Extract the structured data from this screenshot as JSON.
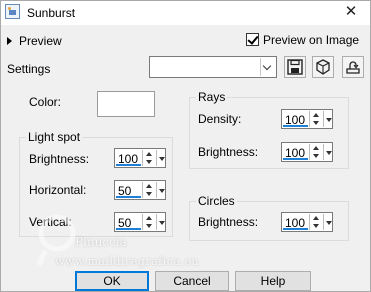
{
  "window": {
    "title": "Sunburst",
    "close_glyph": "✕"
  },
  "preview": {
    "label": "Preview",
    "preview_on_image_label": "Preview on Image",
    "preview_on_image_checked": true
  },
  "settings": {
    "label": "Settings",
    "selected_value": "",
    "icons": [
      "save-preset-icon",
      "reset-icon",
      "load-preset-icon"
    ]
  },
  "color": {
    "label": "Color:",
    "value": "#ffffff"
  },
  "light_spot": {
    "title": "Light spot",
    "brightness_label": "Brightness:",
    "brightness_value": "100",
    "horizontal_label": "Horizontal:",
    "horizontal_value": "50",
    "vertical_label": "Vertical:",
    "vertical_value": "50"
  },
  "rays": {
    "title": "Rays",
    "density_label": "Density:",
    "density_value": "100",
    "brightness_label": "Brightness:",
    "brightness_value": "100"
  },
  "circles": {
    "title": "Circles",
    "brightness_label": "Brightness:",
    "brightness_value": "100"
  },
  "buttons": {
    "ok": "OK",
    "cancel": "Cancel",
    "help": "Help"
  },
  "watermark": {
    "line1": "Pinuccia",
    "line2": "www.maildiregrafica.eu"
  },
  "colors": {
    "accent": "#0078d7",
    "slider": "#1e7fd6"
  }
}
